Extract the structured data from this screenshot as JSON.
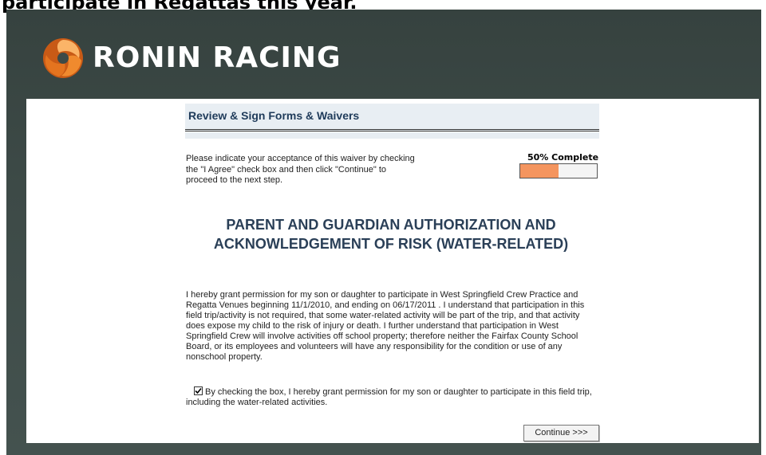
{
  "banner": {
    "text": "participate in Regattas this year."
  },
  "brand": {
    "name": "RONIN RACING",
    "logo_icon": "swirl-logo-icon",
    "logo_colors": [
      "#f08a2e",
      "#c85a16",
      "#fbb468"
    ]
  },
  "form": {
    "title": "Review & Sign Forms & Waivers",
    "intro": "Please indicate your acceptance of this waiver by checking the \"I Agree\" check box and then click \"Continue\" to proceed to the next step.",
    "progress": {
      "label": "50% Complete",
      "value": 0.5,
      "fill_color": "#f4955f"
    },
    "waiver_title_line1": "PARENT AND GUARDIAN AUTHORIZATION AND",
    "waiver_title_line2": "ACKNOWLEDGEMENT OF RISK (WATER-RELATED)",
    "waiver_body": "I hereby grant permission for my son or daughter to participate in West Springfield Crew Practice and Regatta Venues beginning 11/1/2010, and ending on 06/17/2011 . I understand that participation in this field trip/activity is not required, that some water-related activity will be part of the trip, and that activity does expose my child to the risk of injury or death. I further understand that participation in West Springfield Crew will involve activities off school property; therefore neither the Fairfax County School Board, or its employees and volunteers will have any responsibility for the condition or use of any nonschool property.",
    "agree": {
      "checked": true,
      "label": "By checking the box, I hereby grant permission for my son or daughter to participate in this field trip, including the water-related activities."
    },
    "continue_label": "Continue >>>"
  }
}
